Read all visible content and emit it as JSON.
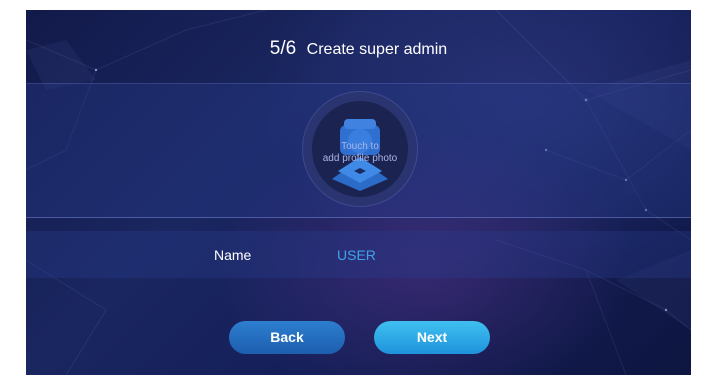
{
  "header": {
    "step": "5/6",
    "title": "Create super admin"
  },
  "avatar": {
    "line1": "Touch to",
    "line2": "add profile photo",
    "icon": "person-placeholder-icon"
  },
  "form": {
    "name_label": "Name",
    "name_value": "USER"
  },
  "buttons": {
    "back": "Back",
    "next": "Next"
  },
  "colors": {
    "background": "#15205a",
    "accent_value": "#3fa3ea",
    "back_button": "#2a78c8",
    "next_button": "#30aeea"
  }
}
